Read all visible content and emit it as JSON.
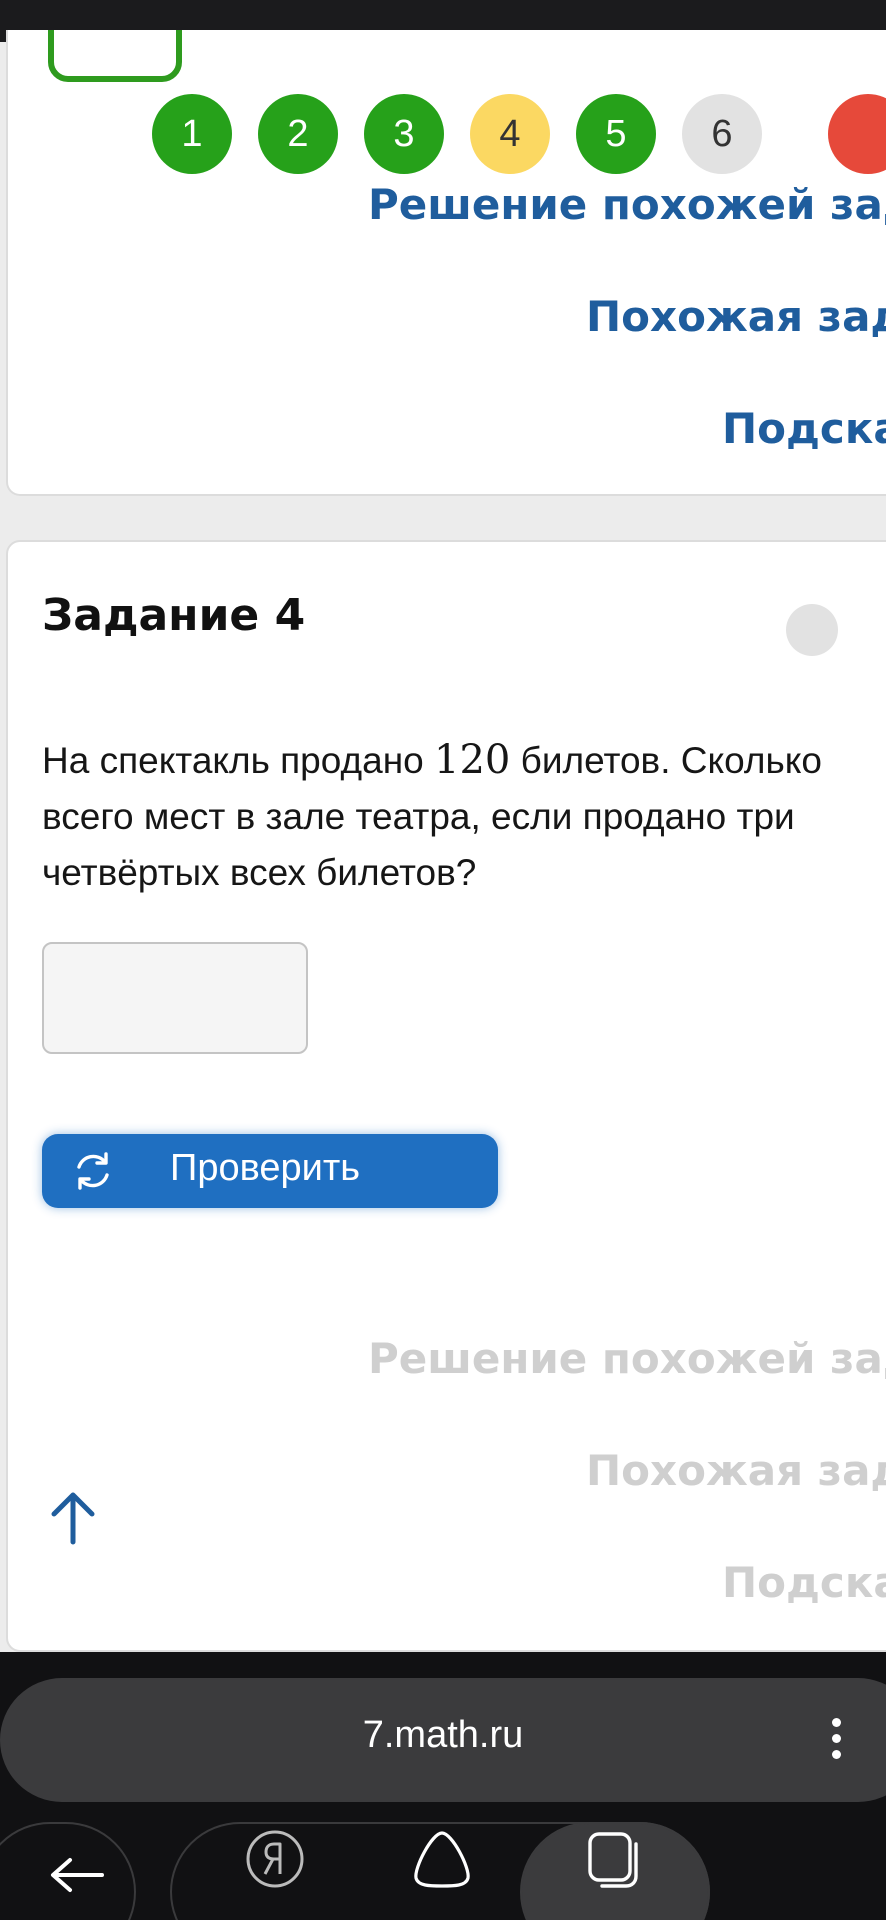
{
  "task_nav": {
    "circles": [
      {
        "label": "1",
        "state": "correct"
      },
      {
        "label": "2",
        "state": "correct"
      },
      {
        "label": "3",
        "state": "correct"
      },
      {
        "label": "4",
        "state": "partial"
      },
      {
        "label": "5",
        "state": "correct"
      },
      {
        "label": "6",
        "state": "unanswered"
      }
    ]
  },
  "prev_links": {
    "similar_solution": "Решение похожей зад",
    "similar_task": "Похожая зад",
    "hint": "Подска"
  },
  "task": {
    "title": "Задание 4",
    "text_line1_before": "На спектакль продано ",
    "text_number": "120",
    "text_line1_after": " билетов. Сколько",
    "text_line2": "всего мест в зале театра, если продано три",
    "text_line3": "четвёртых всех билетов?",
    "answer_value": "",
    "check_label": "Проверить"
  },
  "task_links": {
    "similar_solution": "Решение похожей зад",
    "similar_task": "Похожая зад",
    "hint": "Подска"
  },
  "browser": {
    "url": "7.math.ru"
  },
  "icons": {
    "scroll_top": "arrow-up-icon",
    "check": "refresh-icon",
    "back": "arrow-left-icon",
    "yandex": "yandex-icon",
    "home": "alice-icon",
    "tabs": "tabs-icon"
  },
  "colors": {
    "correct": "#26a11a",
    "partial": "#fbd862",
    "unanswered": "#e2e2e2",
    "link": "#1f5d9d",
    "primary_button": "#1f6fc1"
  }
}
